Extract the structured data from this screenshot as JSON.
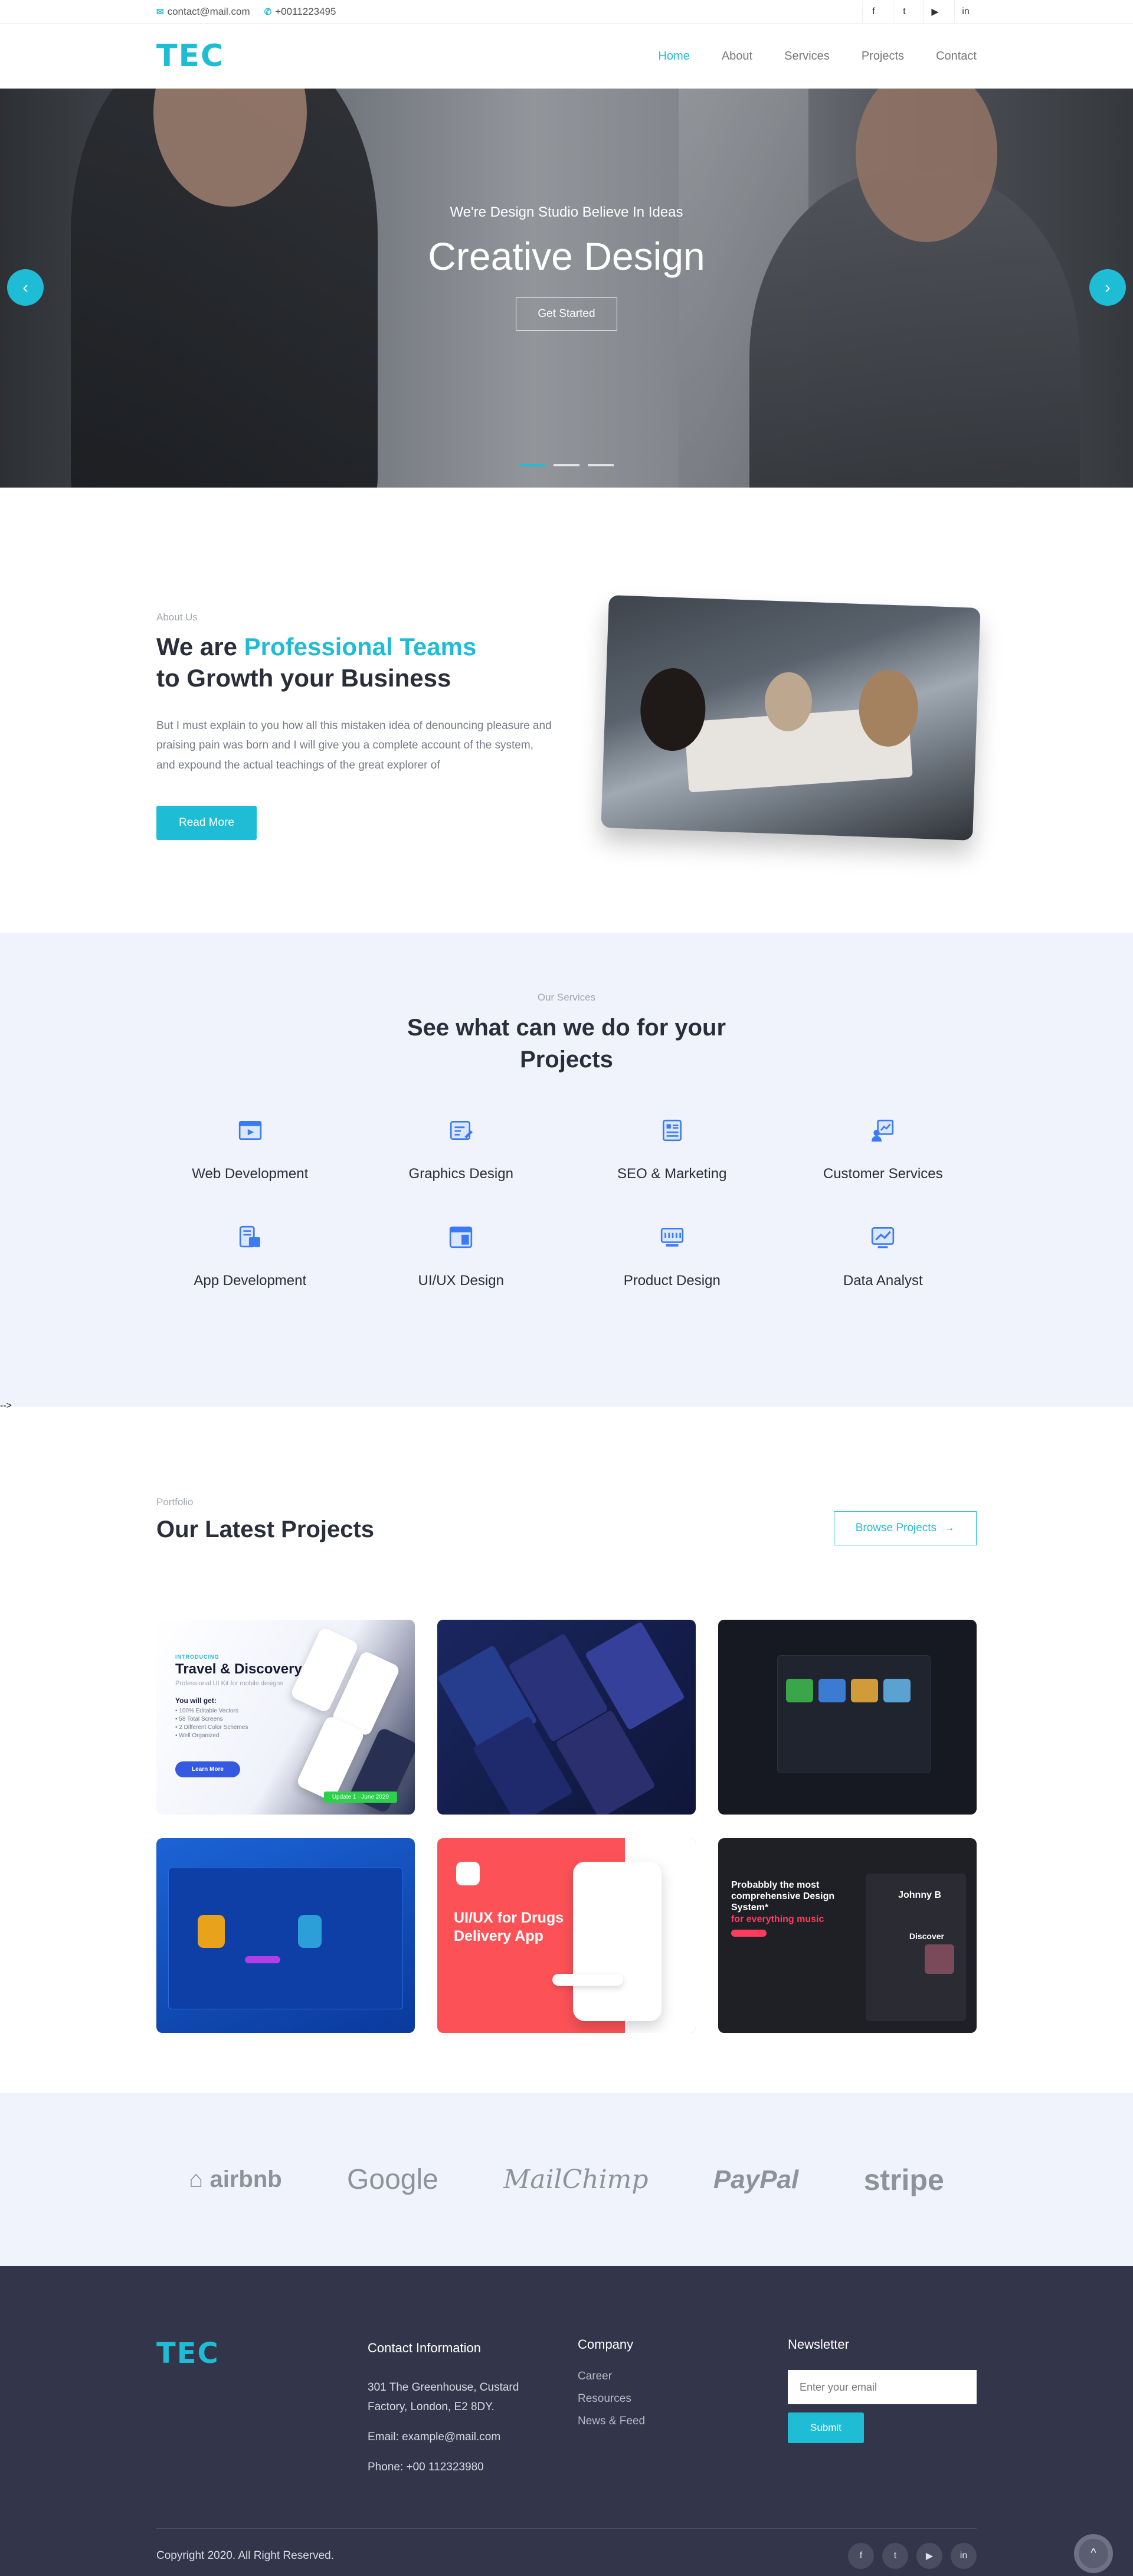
{
  "topbar": {
    "email": "contact@mail.com",
    "phone": "+0011223495",
    "social": [
      "f",
      "t",
      "▶",
      "in"
    ]
  },
  "brand": {
    "logo": "TEC",
    "accent": "#1fbcd6"
  },
  "nav": {
    "items": [
      {
        "label": "Home",
        "active": true
      },
      {
        "label": "About"
      },
      {
        "label": "Services"
      },
      {
        "label": "Projects"
      },
      {
        "label": "Contact"
      }
    ]
  },
  "hero": {
    "kicker": "We're Design Studio Believe In Ideas",
    "title": "Creative Design",
    "cta": "Get Started",
    "prev": "‹",
    "next": "›"
  },
  "about": {
    "eyebrow": "About Us",
    "title_pre": "We are ",
    "title_accent": "Professional Teams",
    "title_post": "to Growth your Business",
    "body": "But I must explain to you how all this mistaken idea of denouncing pleasure and praising pain was born and I will give you a complete account of the system, and expound the actual teachings of the great explorer of",
    "cta": "Read More"
  },
  "services": {
    "eyebrow": "Our Services",
    "title": "See what can we do for your Projects",
    "items": [
      {
        "label": "Web Development",
        "icon": "web-development-icon"
      },
      {
        "label": "Graphics Design",
        "icon": "graphics-design-icon"
      },
      {
        "label": "SEO & Marketing",
        "icon": "seo-marketing-icon"
      },
      {
        "label": "Customer Services",
        "icon": "customer-services-icon"
      },
      {
        "label": "App Development",
        "icon": "app-development-icon"
      },
      {
        "label": "UI/UX Design",
        "icon": "ui-ux-design-icon"
      },
      {
        "label": "Product Design",
        "icon": "product-design-icon"
      },
      {
        "label": "Data Analyst",
        "icon": "data-analyst-icon"
      }
    ]
  },
  "stray": "-->",
  "portfolio": {
    "eyebrow": "Portfolio",
    "title": "Our Latest Projects",
    "cta": "Browse Projects",
    "cta_arrow": "→",
    "card1": {
      "kicker": "INTRODUCING",
      "title": "Travel & Discovery",
      "subtitle": "Professional UI Kit for mobile designs",
      "you_get": "You will get:",
      "bullets": [
        "• 100% Editable Vectors",
        "• 58 Total Screens",
        "• 2 Different Color Schemes",
        "• Well Organized"
      ],
      "cta": "Learn More",
      "badge": "Update 1 · June 2020"
    },
    "card5": {
      "title": "UI/UX for Drugs Delivery App"
    },
    "card6": {
      "title": "Probabbly the most comprehensive Design System*",
      "subtitle": "for everything music",
      "name": "Johnny B",
      "section": "Discover"
    }
  },
  "brands": [
    "airbnb",
    "Google",
    "MailChimp",
    "PayPal",
    "stripe"
  ],
  "footer": {
    "logo": "TEC",
    "contact_title": "Contact Information",
    "address": "301 The Greenhouse, Custard Factory, London, E2 8DY.",
    "email": "Email: example@mail.com",
    "phone": "Phone: +00 112323980",
    "company_title": "Company",
    "company_links": [
      "Career",
      "Resources",
      "News & Feed"
    ],
    "newsletter_title": "Newsletter",
    "newsletter_placeholder": "Enter your email",
    "submit": "Submit",
    "copyright": "Copyright 2020. All Right Reserved.",
    "social": [
      "f",
      "t",
      "▶",
      "in"
    ],
    "to_top": "^"
  }
}
